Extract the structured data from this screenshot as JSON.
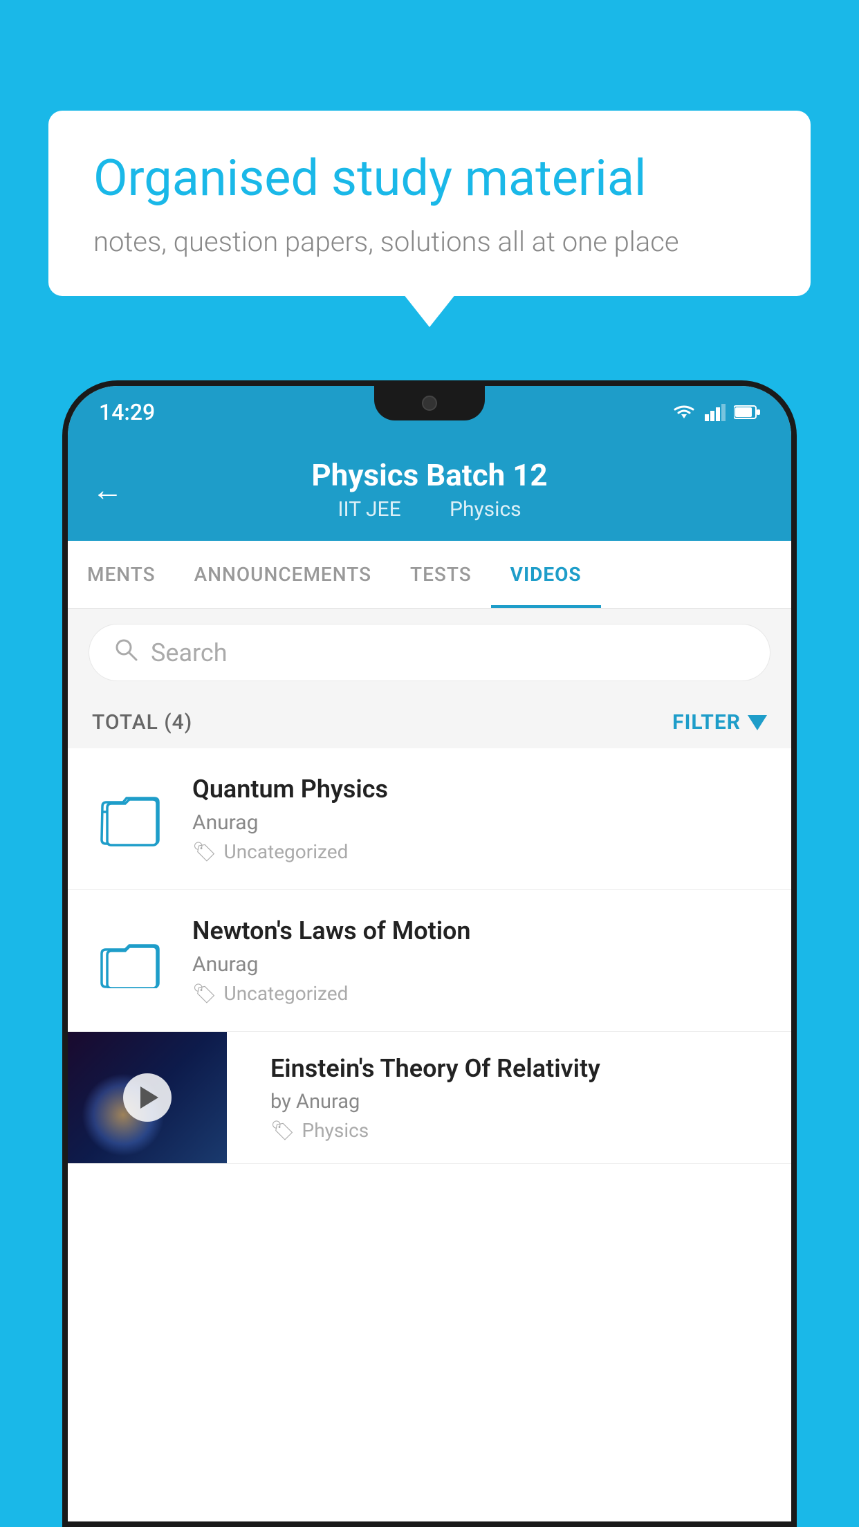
{
  "background_color": "#1ab8e8",
  "bubble": {
    "title": "Organised study material",
    "subtitle": "notes, question papers, solutions all at one place"
  },
  "status_bar": {
    "time": "14:29"
  },
  "app_header": {
    "title": "Physics Batch 12",
    "subtitle_part1": "IIT JEE",
    "subtitle_part2": "Physics",
    "back_label": "←"
  },
  "tabs": [
    {
      "label": "MENTS",
      "active": false
    },
    {
      "label": "ANNOUNCEMENTS",
      "active": false
    },
    {
      "label": "TESTS",
      "active": false
    },
    {
      "label": "VIDEOS",
      "active": true
    }
  ],
  "search": {
    "placeholder": "Search"
  },
  "filter_bar": {
    "total_label": "TOTAL (4)",
    "filter_label": "FILTER"
  },
  "videos": [
    {
      "title": "Quantum Physics",
      "author": "Anurag",
      "tag": "Uncategorized",
      "has_thumb": false
    },
    {
      "title": "Newton's Laws of Motion",
      "author": "Anurag",
      "tag": "Uncategorized",
      "has_thumb": false
    },
    {
      "title": "Einstein's Theory Of Relativity",
      "author": "by Anurag",
      "tag": "Physics",
      "has_thumb": true
    }
  ]
}
